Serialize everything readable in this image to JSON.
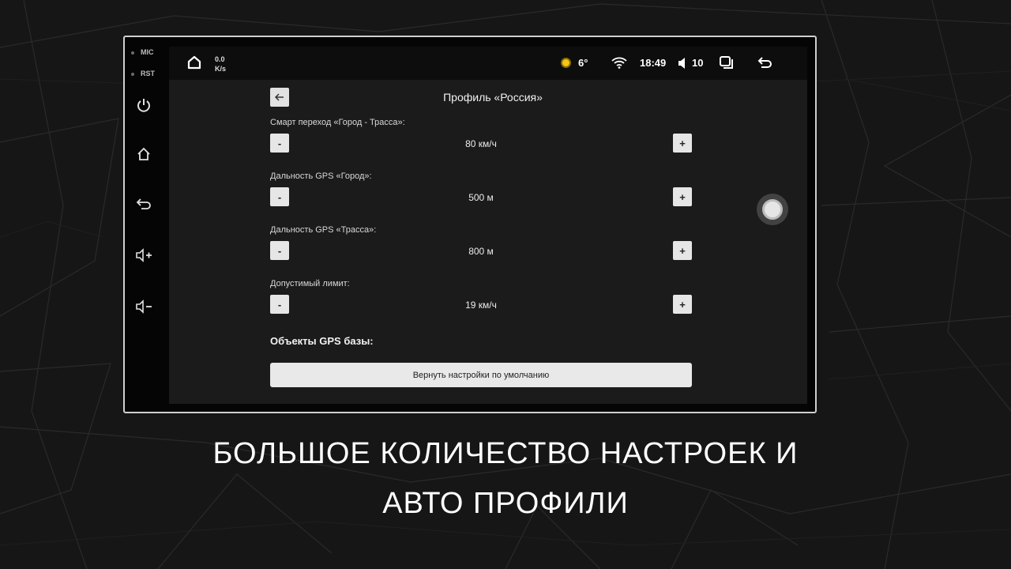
{
  "device": {
    "mic_label": "MIC",
    "rst_label": "RST"
  },
  "statusbar": {
    "net_speed": "0.0",
    "net_unit": "K/s",
    "temperature": "6°",
    "time": "18:49",
    "volume": "10"
  },
  "settings": {
    "title": "Профиль «Россия»",
    "rows": [
      {
        "label": "Смарт переход «Город - Трасса»:",
        "value": "80 км/ч",
        "minus": "-",
        "plus": "+"
      },
      {
        "label": "Дальность GPS «Город»:",
        "value": "500 м",
        "minus": "-",
        "plus": "+"
      },
      {
        "label": "Дальность GPS «Трасса»:",
        "value": "800 м",
        "minus": "-",
        "plus": "+"
      },
      {
        "label": "Допустимый лимит:",
        "value": "19 км/ч",
        "minus": "-",
        "plus": "+"
      }
    ],
    "section_title": "Объекты GPS базы:",
    "reset_label": "Вернуть настройки по умолчанию"
  },
  "caption": {
    "line1": "БОЛЬШОЕ КОЛИЧЕСТВО НАСТРОЕК И",
    "line2": "АВТО ПРОФИЛИ"
  },
  "colors": {
    "sun": "#f5c518",
    "background": "#161616",
    "button_light": "#e6e6e6"
  },
  "icons": [
    "home-icon",
    "sun-icon",
    "wifi-icon",
    "speaker-icon",
    "multiwindow-icon",
    "back-icon",
    "power-icon",
    "volume-up-icon",
    "volume-down-icon",
    "arrow-left-icon"
  ]
}
